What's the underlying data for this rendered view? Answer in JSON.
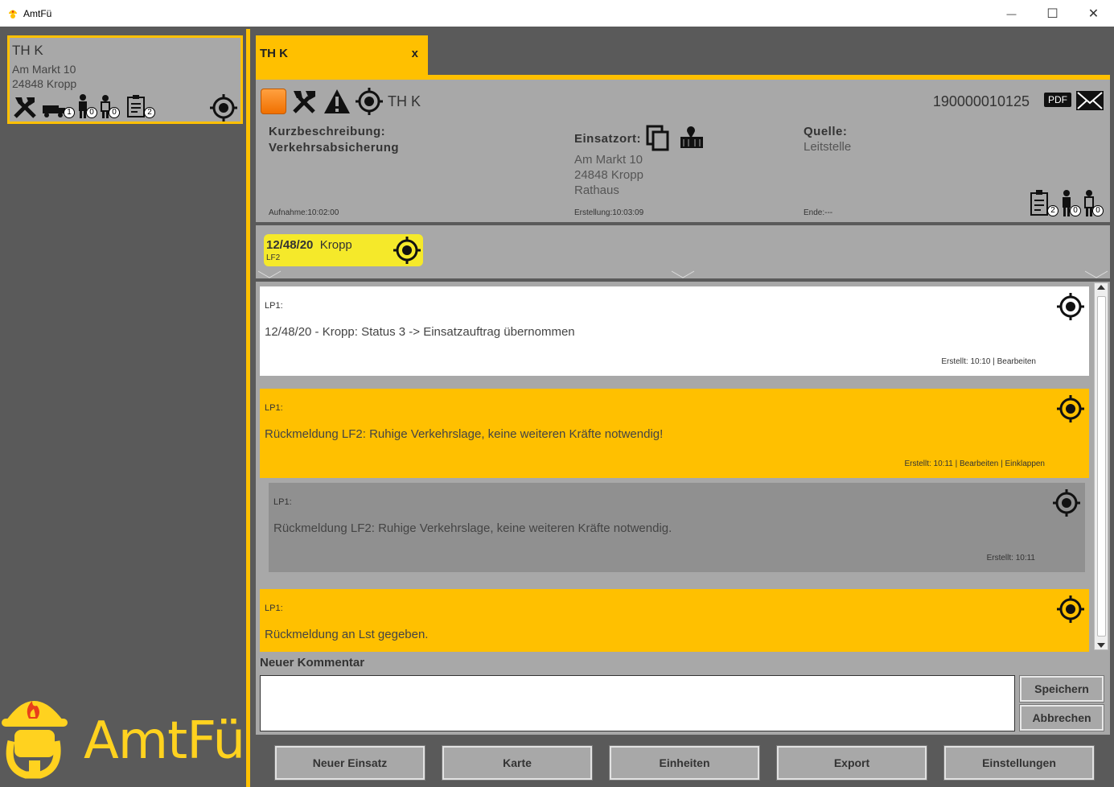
{
  "window": {
    "title": "AmtFü",
    "min": "—",
    "max": "☐",
    "close": "✕"
  },
  "sidebar": {
    "card": {
      "title": "TH K",
      "address1": "Am Markt 10",
      "address2": "24848 Kropp",
      "badges": {
        "vehicle": "1",
        "person1": "0",
        "person2": "0",
        "clipboard": "2"
      }
    },
    "logo_text": "AmtFü"
  },
  "tab": {
    "label": "TH K",
    "close": "x"
  },
  "header": {
    "title": "TH K",
    "number": "190000010125",
    "pdf": "PDF",
    "kurz_label": "Kurzbeschreibung:",
    "kurz_value": "Verkehrsabsicherung",
    "einsatzort_label": "Einsatzort:",
    "addr1": "Am Markt 10",
    "addr2": "24848 Kropp",
    "addr3": "Rathaus",
    "quelle_label": "Quelle:",
    "quelle_value": "Leitstelle",
    "aufnahme": "Aufnahme:10:02:00",
    "erstellung": "Erstellung:10:03:09",
    "ende": "Ende:---",
    "badges": {
      "clipboard": "2",
      "person1": "0",
      "person2": "0"
    }
  },
  "unit": {
    "name_bold": "12/48/20",
    "name": "Kropp",
    "sub": "LF2"
  },
  "messages": [
    {
      "lp": "LP1:",
      "text": "12/48/20 - Kropp: Status 3 -> Einsatzauftrag übernommen",
      "meta": "Erstellt: 10:10 | Bearbeiten"
    },
    {
      "lp": "LP1:",
      "text": "Rückmeldung LF2: Ruhige Verkehrslage, keine weiteren Kräfte notwendig!",
      "meta": "Erstellt: 10:11 | Bearbeiten | Einklappen"
    },
    {
      "lp": "LP1:",
      "text": "Rückmeldung LF2: Ruhige Verkehrslage, keine weiteren Kräfte notwendig.",
      "meta": "Erstellt: 10:11"
    },
    {
      "lp": "LP1:",
      "text": "Rückmeldung an Lst gegeben.",
      "meta": ""
    }
  ],
  "comment": {
    "label": "Neuer Kommentar",
    "value": "",
    "save": "Speichern",
    "cancel": "Abbrechen"
  },
  "bottom_buttons": [
    "Neuer Einsatz",
    "Karte",
    "Einheiten",
    "Export",
    "Einstellungen"
  ],
  "colors": {
    "accent": "#ffc000",
    "panel": "#a8a8a8",
    "bg": "#5a5a5a",
    "unit": "#f5e92a"
  }
}
